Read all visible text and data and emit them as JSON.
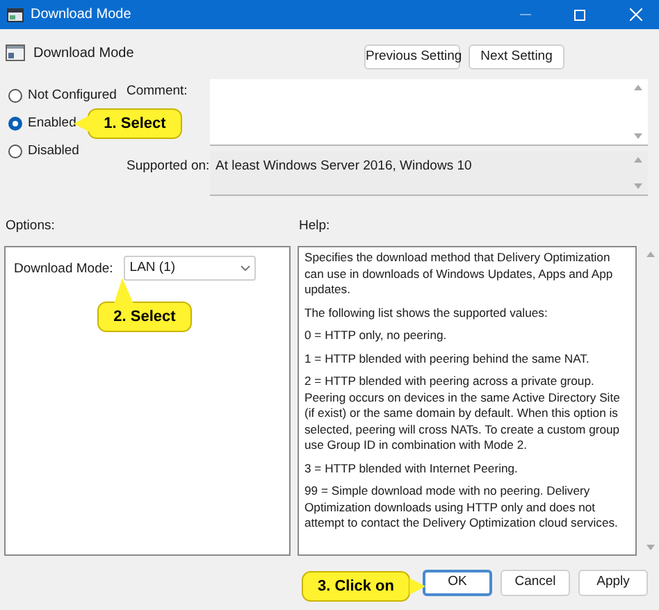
{
  "window": {
    "title": "Download Mode"
  },
  "policy": {
    "name": "Download Mode"
  },
  "nav_buttons": [
    "Previous Setting",
    "Next Setting"
  ],
  "states": [
    {
      "label": "Not Configured",
      "selected": false
    },
    {
      "label": "Enabled",
      "selected": true
    },
    {
      "label": "Disabled",
      "selected": false
    }
  ],
  "comment": {
    "label": "Comment:"
  },
  "supported_on": {
    "label": "Supported on:",
    "value": "At least Windows Server 2016, Windows 10"
  },
  "options": {
    "label": "Options:",
    "field": {
      "label": "Download Mode:",
      "value": "LAN (1)"
    }
  },
  "help": {
    "label": "Help:",
    "paragraphs": [
      "Specifies the download method that Delivery Optimization can use in downloads of Windows Updates, Apps and App updates.",
      "The following list shows the supported values:",
      "0 = HTTP only, no peering.",
      "1 = HTTP blended with peering behind the same NAT.",
      "2 = HTTP blended with peering across a private group. Peering occurs on devices in the same Active Directory Site (if exist) or the same domain by default. When this option is selected, peering will cross NATs. To create a custom group use Group ID in combination with Mode 2.",
      "3 = HTTP blended with Internet Peering.",
      "99 = Simple download mode with no peering. Delivery Optimization downloads using HTTP only and does not attempt to contact the Delivery Optimization cloud services."
    ]
  },
  "buttons": [
    {
      "label": "OK",
      "default": true
    },
    {
      "label": "Cancel",
      "default": false
    },
    {
      "label": "Apply",
      "default": false
    }
  ],
  "callouts": [
    {
      "text": "1. Select"
    },
    {
      "text": "2. Select"
    },
    {
      "text": "3. Click on"
    }
  ]
}
